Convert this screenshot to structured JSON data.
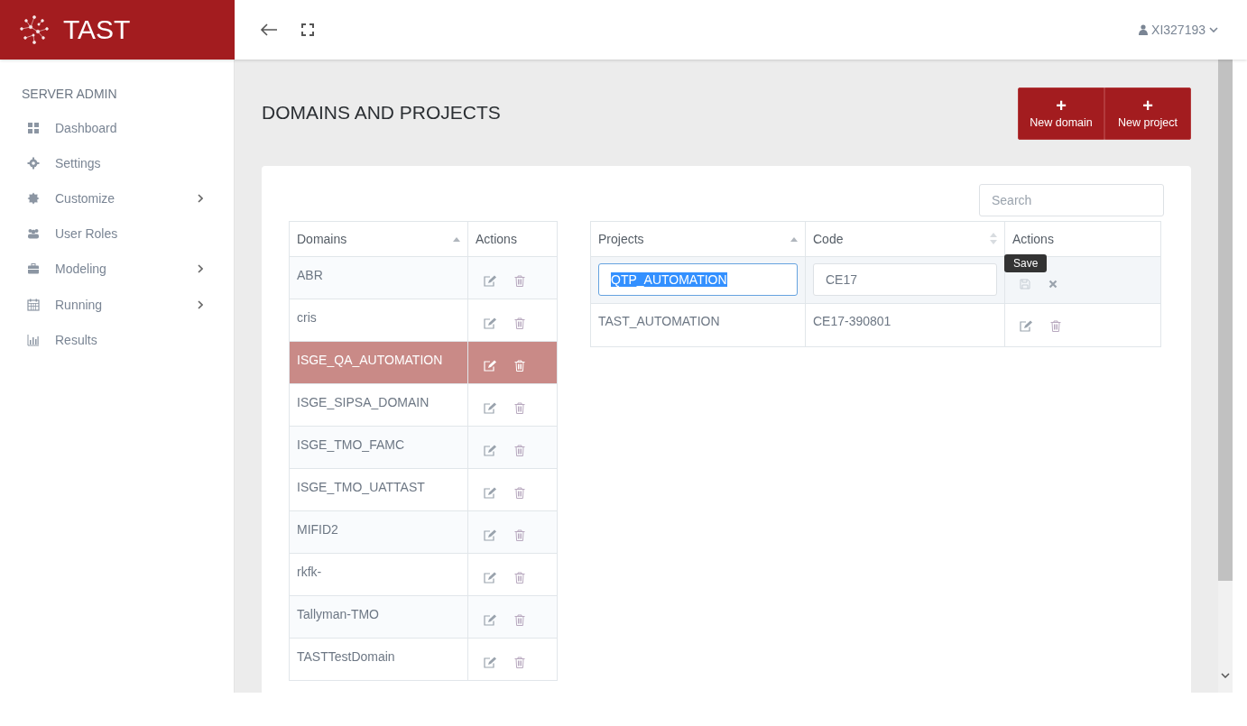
{
  "brand": {
    "name": "TAST"
  },
  "user": {
    "name": "XI327193"
  },
  "sidebar": {
    "section": "SERVER ADMIN",
    "items": [
      {
        "label": "Dashboard",
        "has_submenu": false
      },
      {
        "label": "Settings",
        "has_submenu": false
      },
      {
        "label": "Customize",
        "has_submenu": true
      },
      {
        "label": "User Roles",
        "has_submenu": false
      },
      {
        "label": "Modeling",
        "has_submenu": true
      },
      {
        "label": "Running",
        "has_submenu": true
      },
      {
        "label": "Results",
        "has_submenu": false
      }
    ]
  },
  "page": {
    "title": "DOMAINS AND PROJECTS",
    "buttons": [
      {
        "label": "New domain",
        "icon": "+"
      },
      {
        "label": "New project",
        "icon": "+"
      }
    ]
  },
  "search": {
    "placeholder": "Search"
  },
  "domains": {
    "columns": [
      "Domains",
      "Actions"
    ],
    "rows": [
      {
        "name": "ABR",
        "selected": false
      },
      {
        "name": "cris",
        "selected": false
      },
      {
        "name": "ISGE_QA_AUTOMATION",
        "selected": true
      },
      {
        "name": "ISGE_SIPSA_DOMAIN",
        "selected": false
      },
      {
        "name": "ISGE_TMO_FAMC",
        "selected": false
      },
      {
        "name": "ISGE_TMO_UATTAST",
        "selected": false
      },
      {
        "name": "MIFID2",
        "selected": false
      },
      {
        "name": "rkfk-",
        "selected": false
      },
      {
        "name": "Tallyman-TMO",
        "selected": false
      },
      {
        "name": "TASTTestDomain",
        "selected": false
      }
    ]
  },
  "projects": {
    "columns": [
      "Projects",
      "Code",
      "Actions"
    ],
    "rows": [
      {
        "kind": "editing",
        "name": "QTP_AUTOMATION",
        "name_text_selected": true,
        "code": "CE17",
        "tooltip": "Save"
      },
      {
        "kind": "normal",
        "name": "TAST_AUTOMATION",
        "code": "CE17-390801"
      }
    ]
  }
}
